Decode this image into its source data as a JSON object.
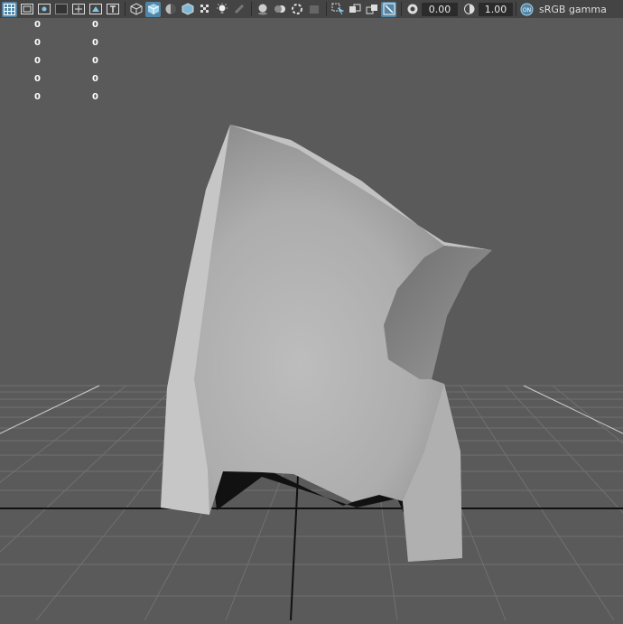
{
  "toolbar": {
    "icons_group1": [
      "grid-icon",
      "film-gate-icon",
      "resolution-gate-icon",
      "gate-mask-icon",
      "field-chart-icon",
      "safe-action-icon",
      "safe-title-icon"
    ],
    "icons_group2": [
      "wireframe-icon",
      "smooth-shade-icon",
      "default-material-icon",
      "shaded-wireframe-icon",
      "textured-icon",
      "use-all-lights-icon",
      "shadows-icon"
    ],
    "icons_group3": [
      "screen-space-ao-icon",
      "motion-blur-icon",
      "multisample-aa-icon",
      "depth-of-field-icon"
    ],
    "icons_group4": [
      "isolate-select-icon",
      "xray-icon",
      "xray-active-components-icon",
      "xray-joints-icon"
    ],
    "exposure_value": "0.00",
    "gamma_value": "1.00",
    "color_space_label": "sRGB gamma",
    "accent_color": "#5285a6"
  },
  "hud": {
    "rows": [
      {
        "left": "0",
        "right": "0"
      },
      {
        "left": "0",
        "right": "0"
      },
      {
        "left": "0",
        "right": "0"
      },
      {
        "left": "0",
        "right": "0"
      },
      {
        "left": "0",
        "right": "0"
      }
    ]
  },
  "viewport": {
    "background_color": "#5a5a5a",
    "grid_color": "#6e6e6e",
    "grid_axis_color": "#101010",
    "mesh_color": "#b7b7b7"
  }
}
